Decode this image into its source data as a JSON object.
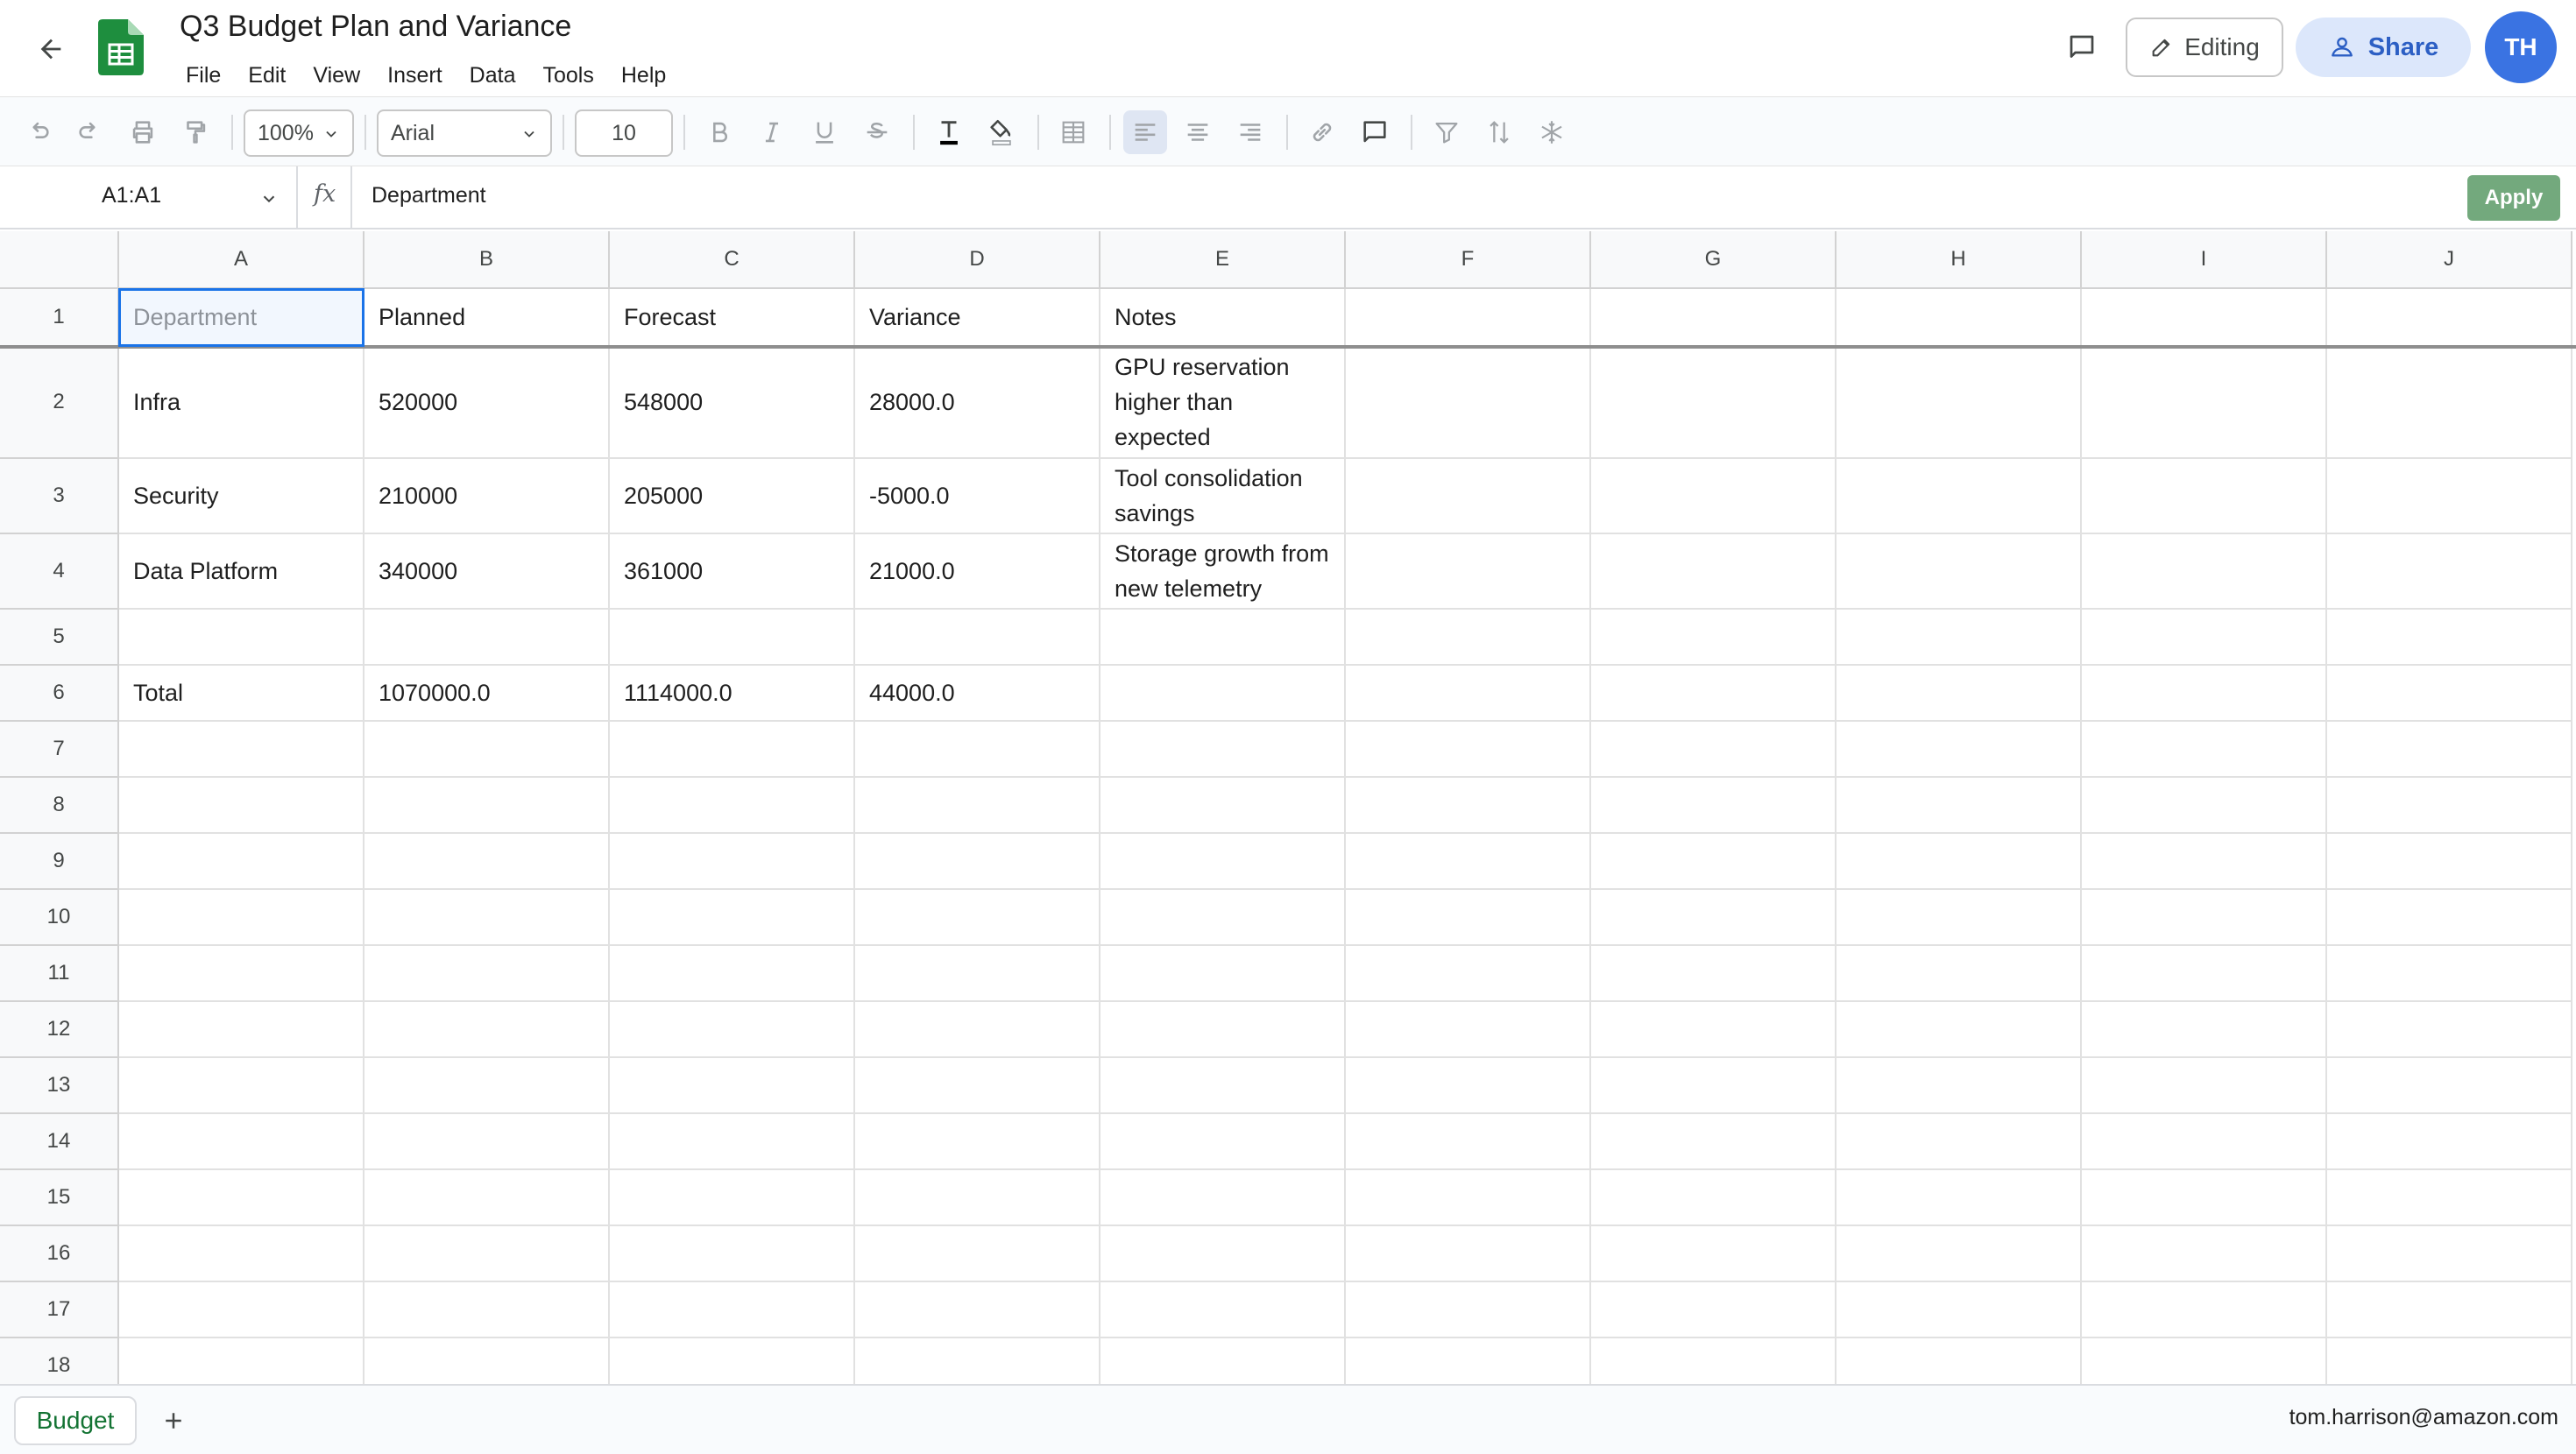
{
  "title_bar": {
    "doc_title": "Q3 Budget Plan and Variance",
    "menu": [
      "File",
      "Edit",
      "View",
      "Insert",
      "Data",
      "Tools",
      "Help"
    ],
    "editing_label": "Editing",
    "share_label": "Share",
    "avatar_initials": "TH"
  },
  "toolbar": {
    "zoom": "100%",
    "font": "Arial",
    "font_size": "10"
  },
  "formula_bar": {
    "name_box": "A1:A1",
    "fx": "fx",
    "value": "Department",
    "apply_label": "Apply"
  },
  "grid": {
    "columns": [
      "A",
      "B",
      "C",
      "D",
      "E",
      "F",
      "G",
      "H",
      "I",
      "J"
    ],
    "row_numbers": [
      "1",
      "2",
      "3",
      "4",
      "5",
      "6",
      "7",
      "8",
      "9",
      "10",
      "11",
      "12",
      "13",
      "14",
      "15",
      "16",
      "17",
      "18"
    ],
    "rows": [
      [
        "Department",
        "Planned",
        "Forecast",
        "Variance",
        "Notes"
      ],
      [
        "Infra",
        "520000",
        "548000",
        "28000.0",
        "GPU reservation higher than expected"
      ],
      [
        "Security",
        "210000",
        "205000",
        "-5000.0",
        "Tool consolidation savings"
      ],
      [
        "Data Platform",
        "340000",
        "361000",
        "21000.0",
        "Storage growth from new telemetry"
      ],
      [
        "",
        "",
        "",
        "",
        ""
      ],
      [
        "Total",
        "1070000.0",
        "1114000.0",
        "44000.0",
        ""
      ]
    ],
    "selected_cell": "A1"
  },
  "sheet_bar": {
    "tabs": [
      "Budget"
    ],
    "account": "tom.harrison@amazon.com"
  },
  "colors": {
    "selection": "#1a73e8",
    "share_bg": "#dce7fb",
    "avatar_bg": "#3a73e2",
    "apply_bg": "#73a97d",
    "sheets_green": "#188038"
  }
}
